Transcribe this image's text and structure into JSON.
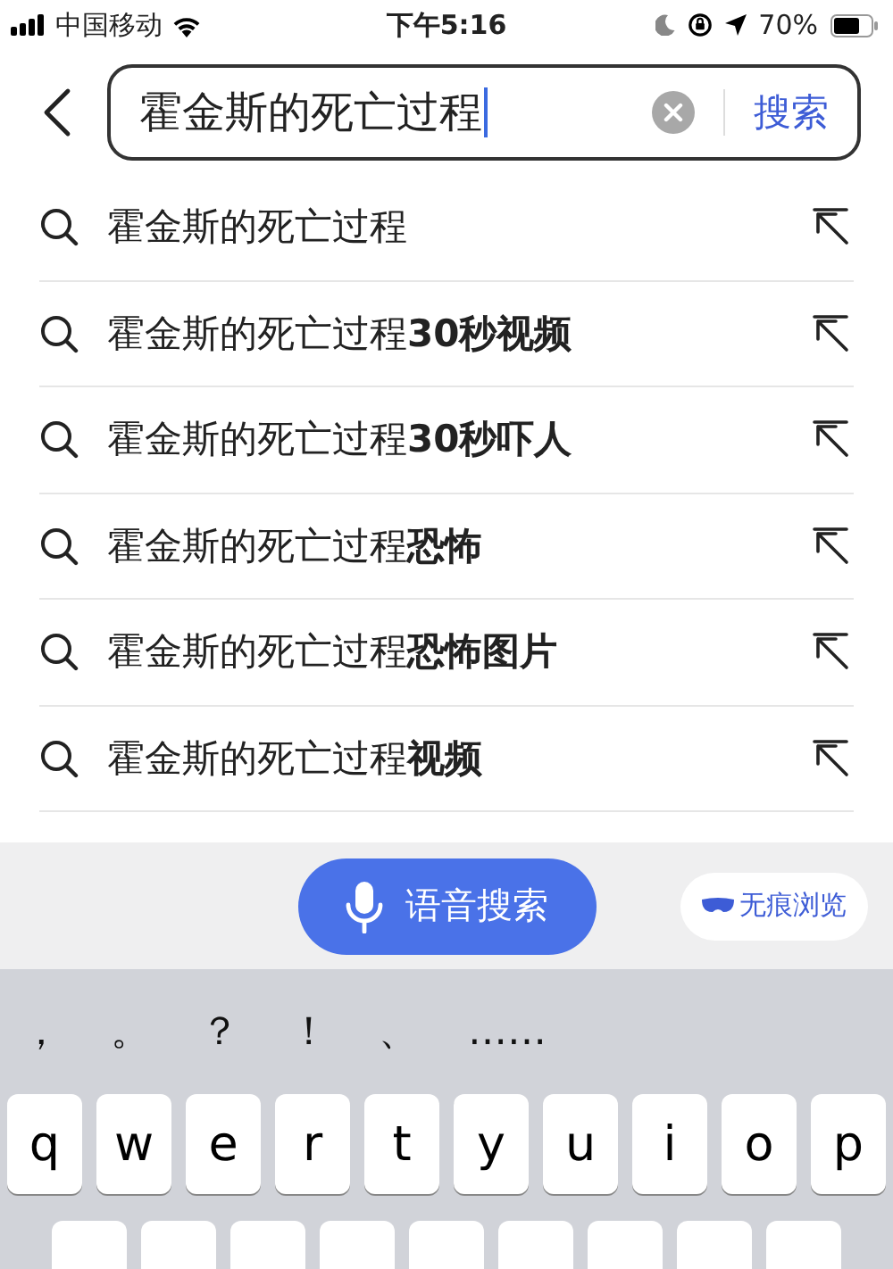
{
  "status_bar": {
    "carrier": "中国移动",
    "time": "下午5:16",
    "battery": "70%"
  },
  "search": {
    "value": "霍金斯的死亡过程",
    "button": "搜索"
  },
  "suggestions": [
    {
      "text": "霍金斯的死亡过程"
    },
    {
      "text": "霍金斯的死亡过程**30秒视频**"
    },
    {
      "text": "霍金斯的死亡过程**30秒吓人**"
    },
    {
      "text": "霍金斯的死亡过程**恐怖**"
    },
    {
      "text": "霍金斯的死亡过程**恐怖图片**"
    },
    {
      "text": "霍金斯的死亡过程**视频**"
    }
  ],
  "toolbar": {
    "voice_button": "语音搜索",
    "incognito_button": "无痕浏览"
  },
  "keyboard": {
    "punctuation": [
      "，",
      "。",
      "？",
      "！",
      "、",
      "……"
    ],
    "rows": [
      [
        "q",
        "w",
        "e",
        "r",
        "t",
        "y",
        "u",
        "i",
        "o",
        "p"
      ]
    ]
  }
}
